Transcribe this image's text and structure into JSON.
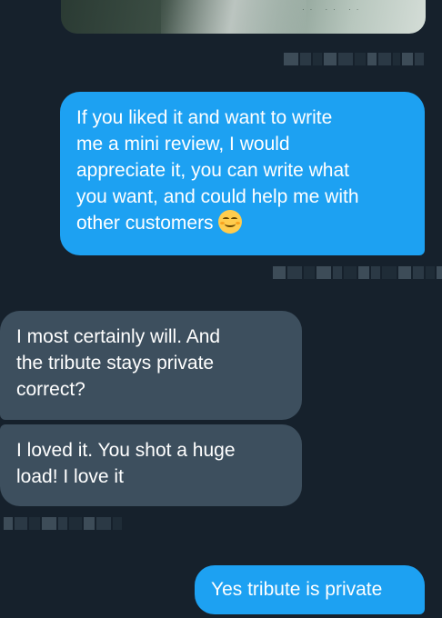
{
  "conversation": {
    "attachment_icon": "image-attachment-icon",
    "messages": [
      {
        "direction": "outgoing",
        "lines": [
          "If you liked it and want to  write",
          "me a mini review, I would",
          "appreciate it, you can write what",
          "you want, and could help me with",
          "other customers"
        ],
        "emoji": "smiling-face-with-smiling-eyes-emoji"
      },
      {
        "direction": "incoming",
        "lines": [
          "I most certainly will. And",
          "the tribute stays private",
          "correct?"
        ]
      },
      {
        "direction": "incoming",
        "lines": [
          "I loved it. You shot a huge",
          "load! I love it"
        ]
      },
      {
        "direction": "outgoing",
        "lines": [
          "Yes tribute is private"
        ]
      }
    ]
  },
  "colors": {
    "background": "#16212c",
    "outgoing_bubble": "#1da1f2",
    "incoming_bubble": "#3d4f5e",
    "text": "#ffffff"
  }
}
